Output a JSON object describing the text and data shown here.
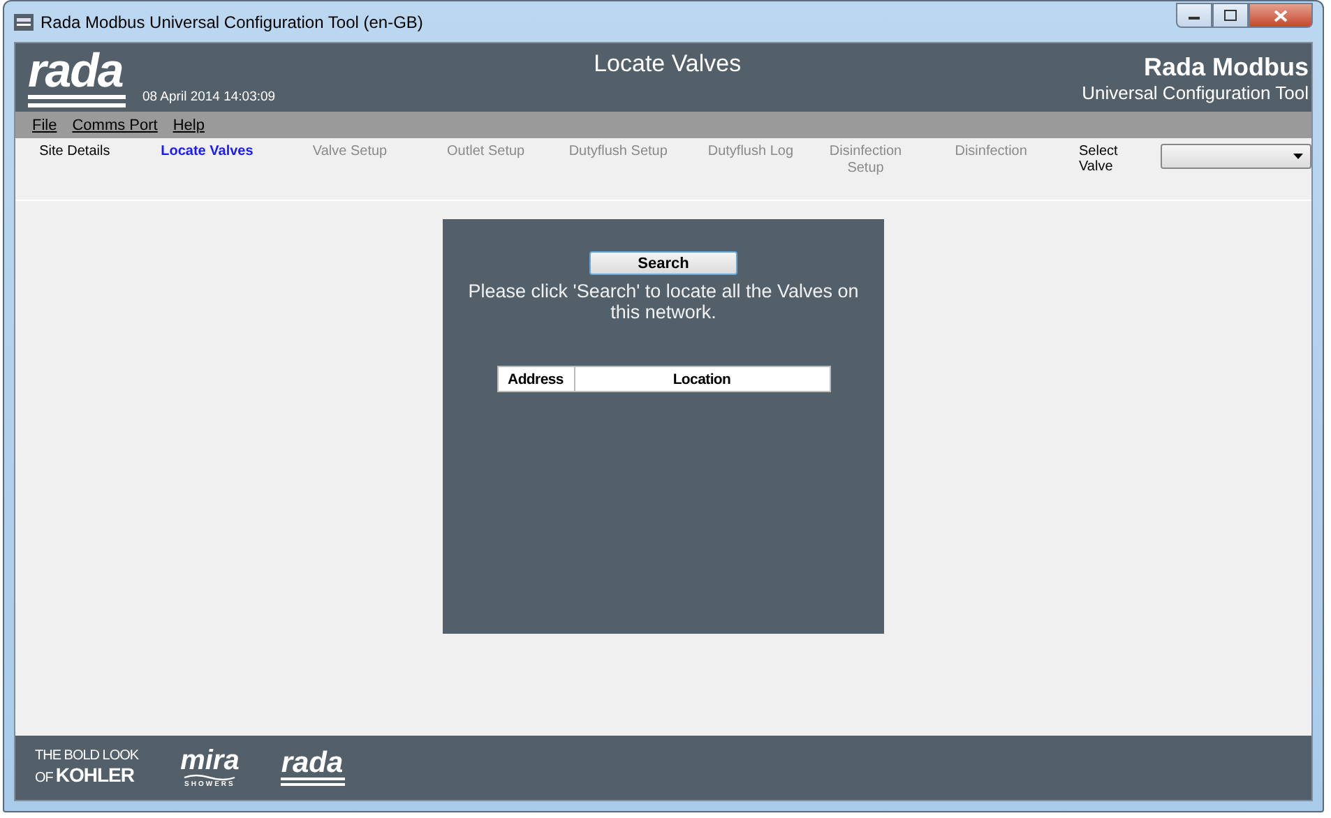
{
  "window": {
    "title": "Rada Modbus Universal Configuration Tool (en-GB)"
  },
  "header": {
    "logo": "rada",
    "datetime": "08 April 2014 14:03:09",
    "page_title": "Locate Valves",
    "brand": "Rada Modbus",
    "subtitle": "Universal Configuration Tool"
  },
  "menu": [
    {
      "label": "File"
    },
    {
      "label": "Comms Port"
    },
    {
      "label": "Help"
    }
  ],
  "tabs": [
    {
      "label": "Site Details",
      "selected": false,
      "disabled": false
    },
    {
      "label": "Locate Valves",
      "selected": true,
      "disabled": false
    },
    {
      "label": "Valve Setup",
      "selected": false,
      "disabled": true
    },
    {
      "label": "Outlet Setup",
      "selected": false,
      "disabled": true
    },
    {
      "label": "Dutyflush Setup",
      "selected": false,
      "disabled": true
    },
    {
      "label": "Dutyflush Log",
      "selected": false,
      "disabled": true
    },
    {
      "label": "Disinfection Setup",
      "selected": false,
      "disabled": true
    },
    {
      "label": "Disinfection",
      "selected": false,
      "disabled": true
    }
  ],
  "select_valve": {
    "label": "Select Valve"
  },
  "panel": {
    "button": "Search",
    "message": "Please click 'Search' to locate all the Valves on this network.",
    "table": {
      "columns": [
        "Address",
        "Location"
      ]
    }
  },
  "footer": {
    "kohler_line1": "THE BOLD LOOK",
    "kohler_of": "OF",
    "kohler_brand": "KOHLER",
    "mira": "mira",
    "mira_sub": "SHOWERS",
    "rada": "rada"
  }
}
